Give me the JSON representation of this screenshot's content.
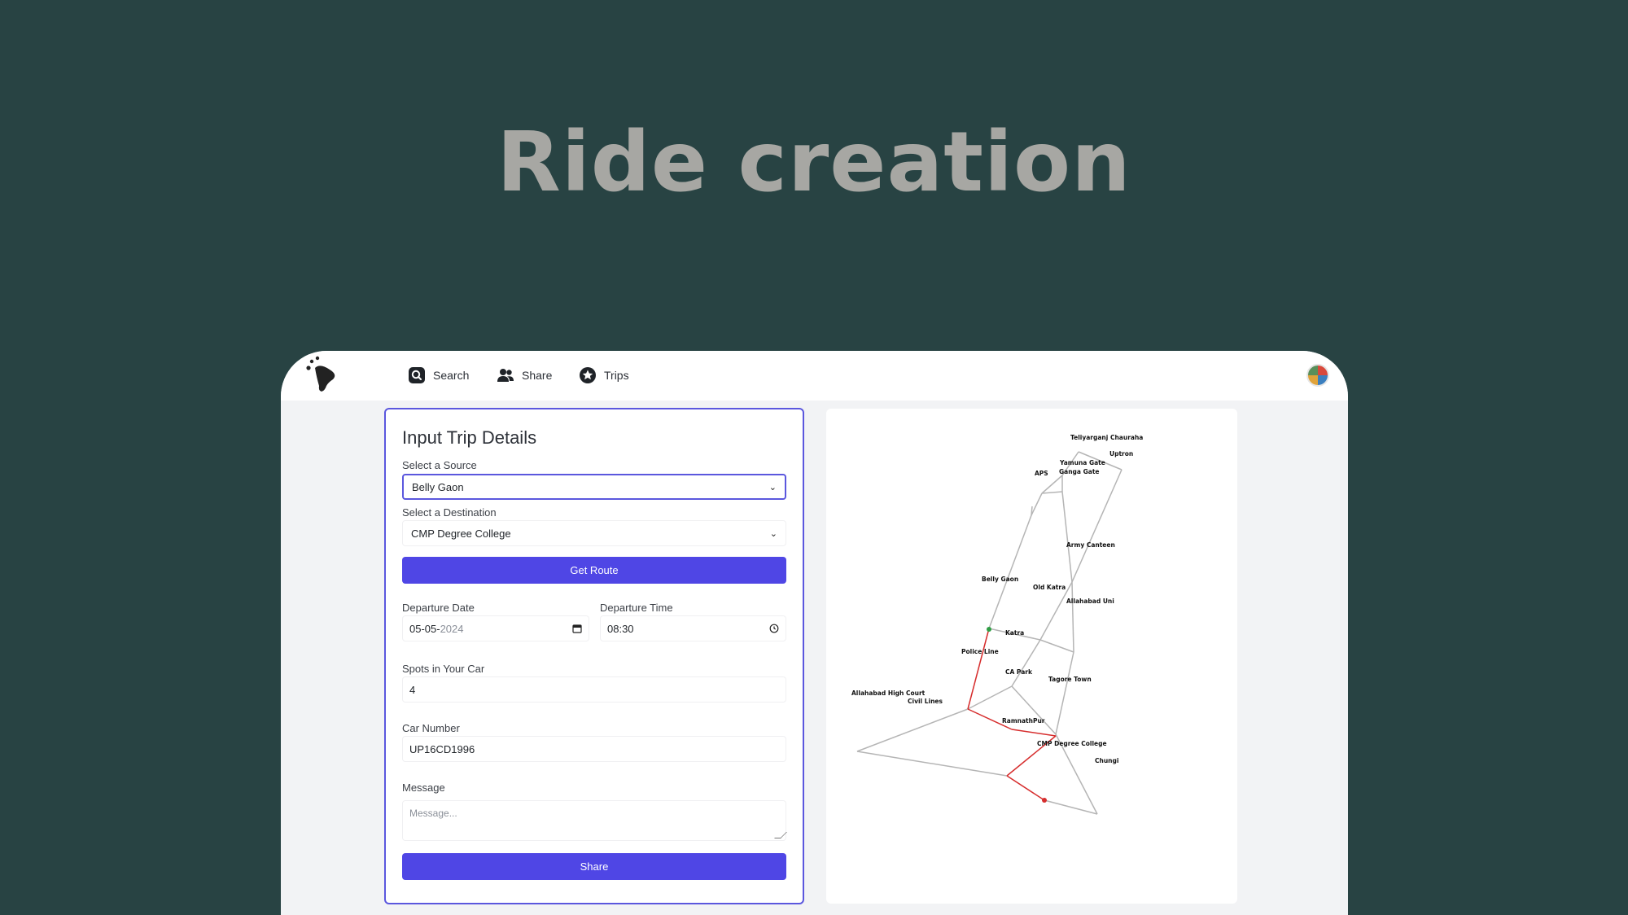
{
  "hero": {
    "title": "Ride creation"
  },
  "nav": {
    "items": [
      {
        "label": "Search",
        "icon": "search-icon"
      },
      {
        "label": "Share",
        "icon": "users-icon"
      },
      {
        "label": "Trips",
        "icon": "star-icon"
      }
    ]
  },
  "form": {
    "title": "Input Trip Details",
    "source_label": "Select a Source",
    "source_value": "Belly Gaon",
    "destination_label": "Select a Destination",
    "destination_value": "CMP Degree College",
    "get_route_label": "Get Route",
    "departure_date_label": "Departure Date",
    "departure_date_day_month": "05-05-",
    "departure_date_year": "2024",
    "departure_time_label": "Departure Time",
    "departure_time_value": "08:30",
    "spots_label": "Spots in Your Car",
    "spots_value": "4",
    "car_number_label": "Car Number",
    "car_number_value": "UP16CD1996",
    "message_label": "Message",
    "message_placeholder": "Message...",
    "share_label": "Share"
  },
  "map": {
    "colors": {
      "edge": "#b5b5b5",
      "route": "#d62d2d",
      "source": "#2f9e44",
      "destination": "#d62d2d"
    },
    "nodes": {
      "teliyarganj": "Teliyarganj Chauraha",
      "uptron": "Uptron",
      "yamuna_gate": "Yamuna Gate",
      "ganga_gate": "Ganga Gate",
      "aps": "APS",
      "army_canteen": "Army Canteen",
      "belly_gaon": "Belly Gaon",
      "old_katra": "Old Katra",
      "allahabad_uni": "Allahabad Uni",
      "katra": "Katra",
      "police_line": "Police Line",
      "ca_park": "CA Park",
      "tagore_town": "Tagore Town",
      "allahabad_high_court": "Allahabad High Court",
      "civil_lines": "Civil Lines",
      "rambagh": "RamnathPur",
      "cmp": "CMP Degree College",
      "chungi": "Chungi"
    }
  }
}
